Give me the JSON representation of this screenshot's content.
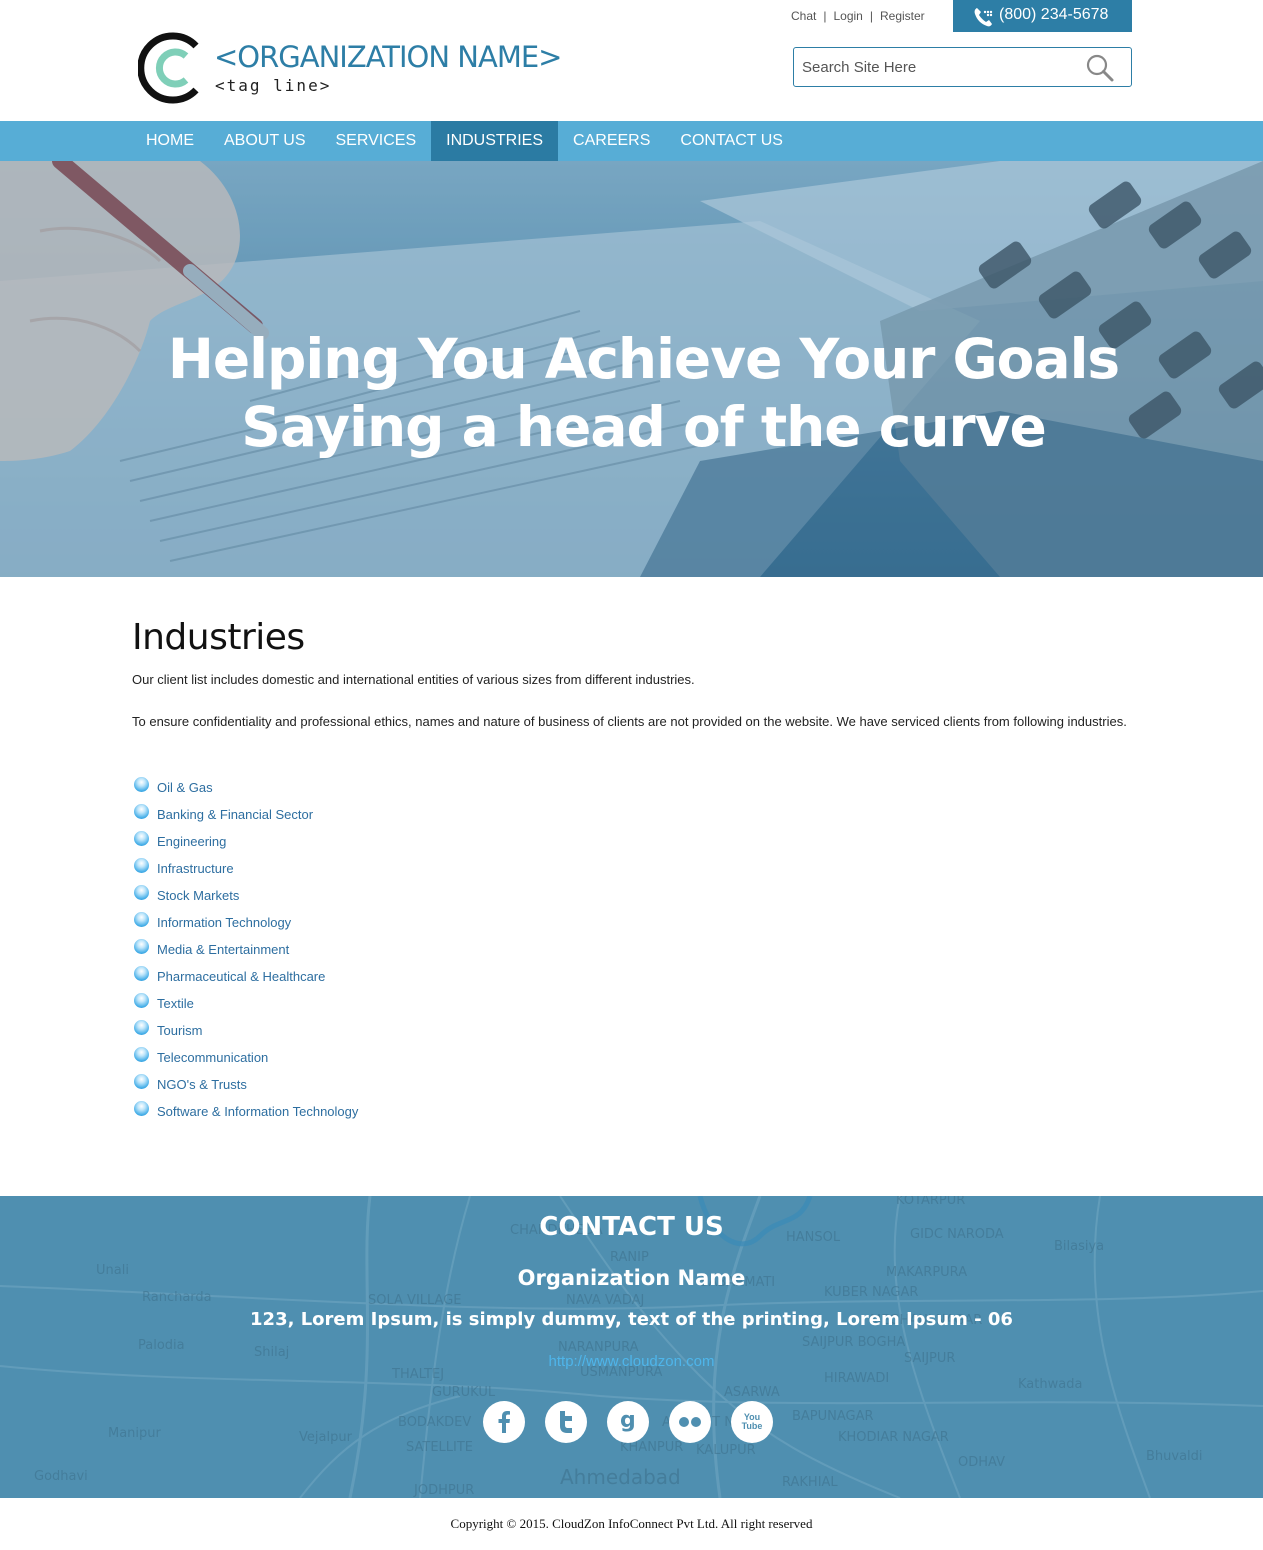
{
  "header": {
    "org_name": "<ORGANIZATION NAME>",
    "tag_line": "<tag line>",
    "top_links": {
      "chat": "Chat",
      "login": "Login",
      "register": "Register"
    },
    "phone": "(800) 234-5678",
    "search_placeholder": "Search Site Here"
  },
  "nav": {
    "items": [
      {
        "label": "HOME"
      },
      {
        "label": "ABOUT US"
      },
      {
        "label": "SERVICES"
      },
      {
        "label": "INDUSTRIES",
        "active": true
      },
      {
        "label": "CAREERS"
      },
      {
        "label": "CONTACT US"
      }
    ]
  },
  "hero": {
    "line1": "Helping You Achieve Your Goals",
    "line2": "Saying a head of the curve"
  },
  "main": {
    "title": "Industries",
    "intro": "Our client list includes domestic and international entities of various sizes from different industries.",
    "body": "To ensure confidentiality and professional ethics, names and nature of business of clients are not provided on the website. We have serviced clients from following industries.",
    "industries": [
      "Oil & Gas",
      "Banking & Financial Sector",
      "Engineering",
      "Infrastructure",
      "Stock Markets",
      "Information Technology",
      "Media & Entertainment",
      "Pharmaceutical & Healthcare",
      "Textile",
      "Tourism",
      "Telecommunication",
      "NGO's & Trusts",
      "Software & Information Technology"
    ]
  },
  "contact": {
    "title": "CONTACT US",
    "org": "Organization Name",
    "address": "123, Lorem Ipsum, is simply dummy, text of the printing, Lorem Ipsum - 06",
    "url": "http://www.cloudzon.com",
    "social": [
      "facebook-icon",
      "twitter-icon",
      "google-icon",
      "flickr-icon",
      "youtube-icon"
    ],
    "map_labels": [
      "Unali",
      "Rancharda",
      "Palodia",
      "Shilaj",
      "Manipur",
      "Godhavi",
      "SOLA VILLAGE",
      "THALTEJ",
      "GURUKUL",
      "BODAKDEV",
      "SATELLITE",
      "Vejalpur",
      "JODHPUR",
      "NAVA VADAJ",
      "RANIP",
      "NARANPURA",
      "USMANPURA",
      "ASARWA",
      "Ahmedabad",
      "KHANPUR",
      "KALUPUR",
      "HANSOL",
      "KUBER NAGAR",
      "SAIJPUR BOGHA",
      "HIRAWADI",
      "BAPUNAGAR",
      "KHODIAR NAGAR",
      "RAKHIAL",
      "ODHAV",
      "GIDC NARODA",
      "MAKARPURA",
      "Bilasiya",
      "Kathwada",
      "Bhuvaldi",
      "KOTARPUR",
      "CHANDKHEDA",
      "SABARMATI",
      "MEGHANI NAGAR",
      "ARIHANT NAGAR",
      "SAIJPUR"
    ],
    "youtube_text": "You Tube",
    "google_text": "g"
  },
  "footer": {
    "copyright": "Copyright © 2015. CloudZon InfoConnect Pvt Ltd. All right reserved"
  },
  "colors": {
    "brand": "#2d7ea6",
    "nav": "#57add6",
    "nav_active": "#2b7ba3",
    "logo_accent": "#7fcfb8",
    "link": "#2d6ea0",
    "contact_bg": "#4f8fb0",
    "url": "#4fb5ea"
  }
}
